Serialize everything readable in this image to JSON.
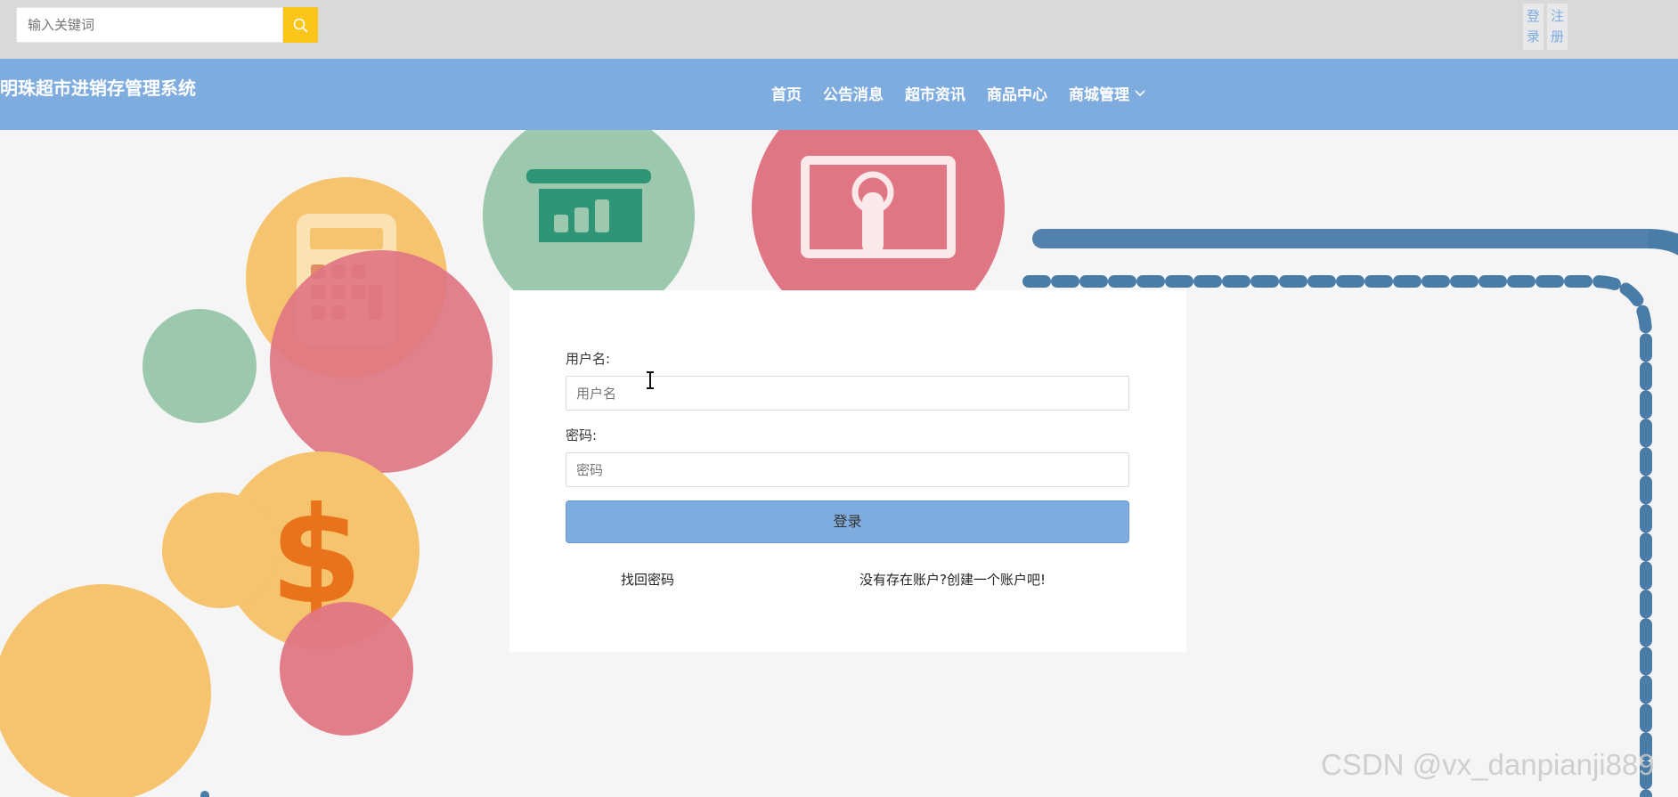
{
  "search": {
    "placeholder": "输入关键词",
    "icon": "search-icon"
  },
  "auth": {
    "login": "登录",
    "register": "注册"
  },
  "header": {
    "site_title": "明珠超市进销存管理系统",
    "nav": [
      "首页",
      "公告消息",
      "超市资讯",
      "商品中心",
      "商城管理"
    ]
  },
  "login_form": {
    "username_label": "用户名:",
    "username_placeholder": "用户名",
    "password_label": "密码:",
    "password_placeholder": "密码",
    "submit_label": "登录",
    "forgot_password": "找回密码",
    "register_prompt": "没有存在账户?创建一个账户吧!"
  },
  "watermark": "CSDN @vx_danpianji889",
  "colors": {
    "topbar_bg": "#d9d9d9",
    "nav_bg": "#7facdf",
    "search_btn": "#fcc51a",
    "accent_blue": "#7facdf"
  }
}
